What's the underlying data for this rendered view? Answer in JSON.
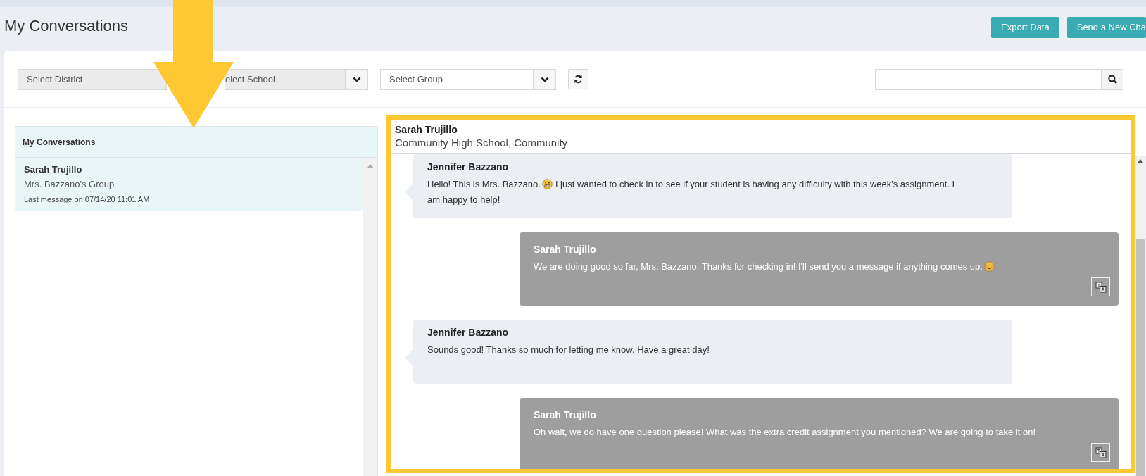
{
  "page": {
    "title": "My Conversations"
  },
  "header_buttons": [
    {
      "label": "Export Data"
    },
    {
      "label": "Send a New Cha"
    }
  ],
  "filters": [
    {
      "kind": "select",
      "value": "Select District",
      "disabled": true
    },
    {
      "kind": "select",
      "value": "elect School",
      "disabled": true
    },
    {
      "kind": "select",
      "value": "Select Group",
      "disabled": false
    }
  ],
  "conversation_list": {
    "title": "My Conversations",
    "items": [
      {
        "name": "Sarah Trujillo",
        "group": "Mrs. Bazzano's Group",
        "last_message": "Last message on 07/14/20 11:01 AM",
        "selected": true
      }
    ]
  },
  "chat": {
    "contact_name": "Sarah Trujillo",
    "contact_school": "Community High School, Community",
    "messages": [
      {
        "kind": "received",
        "sender": "Jennifer Bazzano",
        "segments": [
          {
            "kind": "text",
            "text": "Hello! This is Mrs. Bazzano."
          },
          {
            "kind": "grin"
          },
          {
            "kind": "text",
            "text": "I just wanted to check in to see if your student is having any difficulty with this week's assignment. I"
          },
          {
            "kind": "line",
            "text": "am happy to help!"
          }
        ]
      },
      {
        "kind": "sent",
        "sender": "Sarah Trujillo",
        "segments": [
          {
            "kind": "text",
            "text": "We are doing good so far, Mrs. Bazzano. Thanks for checking in! I'll send you a message if anything comes up."
          },
          {
            "kind": "smile"
          }
        ]
      },
      {
        "kind": "received",
        "sender": "Jennifer Bazzano",
        "segments": [
          {
            "kind": "text",
            "text": "Sounds good! Thanks so much for letting me know. Have a great day!"
          }
        ]
      },
      {
        "kind": "sent",
        "sender": "Sarah Trujillo",
        "segments": [
          {
            "kind": "text",
            "text": "Oh wait, we do have one question please! What was the extra credit assignment you mentioned? We are going to take it on!"
          }
        ]
      }
    ]
  }
}
